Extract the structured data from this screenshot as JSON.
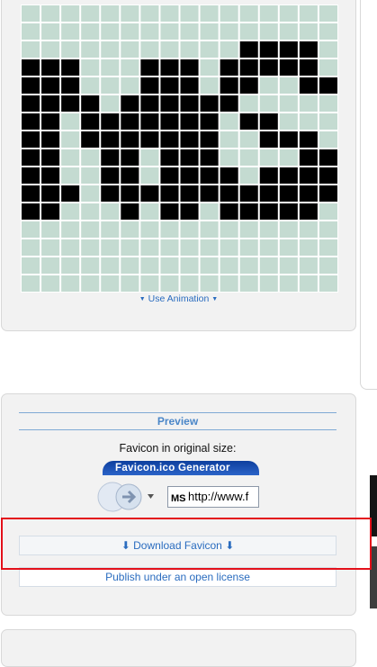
{
  "editor": {
    "animation_link": "Use Animation",
    "grid": {
      "cols": 16,
      "rows": 16,
      "empty_color": "#c4dbd1",
      "filled_color": "#000000",
      "line_color": "#ffffff",
      "rows_pattern": [
        "0000000000000000",
        "0000000000000000",
        "0000000000011110",
        "1110001110111110",
        "1110001110110011",
        "1111011111100000",
        "1101111111011000",
        "1101111111001110",
        "1100110111000011",
        "1100110111101111",
        "1110111111111111",
        "1100010110111110",
        "0000000000000000",
        "0000000000000000",
        "0000000000000000",
        "0000000000000000"
      ]
    }
  },
  "preview": {
    "header": "Preview",
    "original_size_label": "Favicon in original size:",
    "browser_title": "Favicon.ico Generator",
    "address_text": "http://www.f",
    "favicon_text": "MS",
    "download_button": "⬇ Download Favicon ⬇",
    "publish_link": "Publish under an open license"
  },
  "colors": {
    "accent": "#2a6cbf",
    "highlight": "#e3101a",
    "panel_bg": "#f2f2f2"
  }
}
